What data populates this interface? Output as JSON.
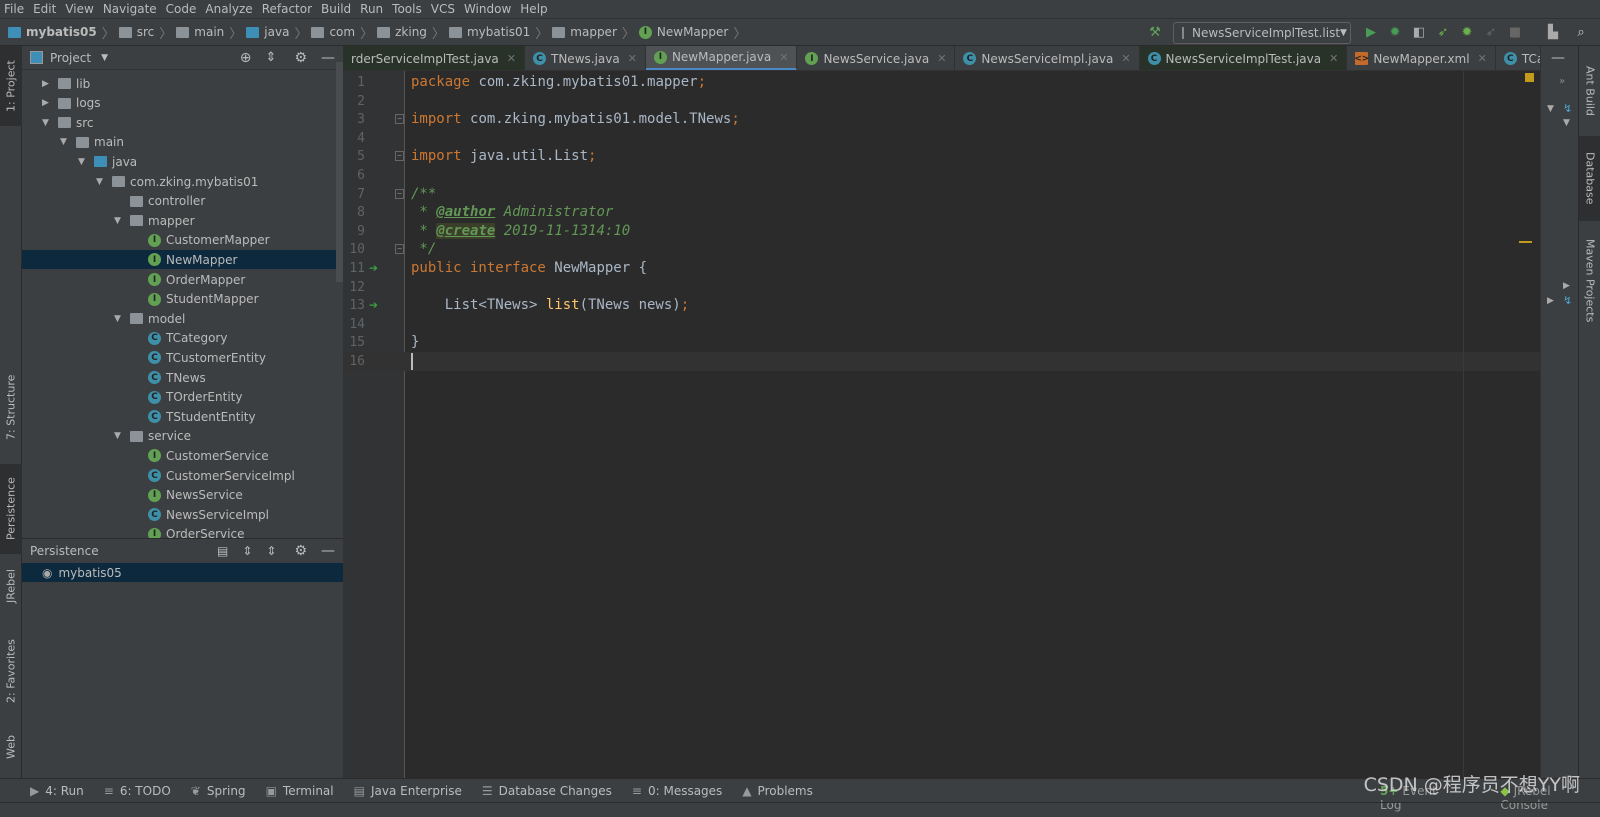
{
  "menu": [
    "File",
    "Edit",
    "View",
    "Navigate",
    "Code",
    "Analyze",
    "Refactor",
    "Build",
    "Run",
    "Tools",
    "VCS",
    "Window",
    "Help"
  ],
  "breadcrumb": [
    {
      "label": "mybatis05",
      "icon": "module"
    },
    {
      "label": "src",
      "icon": "folder"
    },
    {
      "label": "main",
      "icon": "folder"
    },
    {
      "label": "java",
      "icon": "source-folder"
    },
    {
      "label": "com",
      "icon": "package"
    },
    {
      "label": "zking",
      "icon": "package"
    },
    {
      "label": "mybatis01",
      "icon": "package"
    },
    {
      "label": "mapper",
      "icon": "package"
    },
    {
      "label": "NewMapper",
      "icon": "interface"
    }
  ],
  "toolbar": {
    "run_config": "NewsServiceImplTest.list"
  },
  "left_tools": [
    "1: Project",
    "7: Structure",
    "Persistence",
    "JRebel",
    "2: Favorites",
    "Web"
  ],
  "right_tools": [
    "Ant Build",
    "Database",
    "Maven Projects"
  ],
  "project": {
    "title": "Project",
    "tree": [
      {
        "label": "lib",
        "depth": 0,
        "type": "folder",
        "expand": "closed"
      },
      {
        "label": "logs",
        "depth": 0,
        "type": "folder",
        "expand": "closed"
      },
      {
        "label": "src",
        "depth": 0,
        "type": "folder",
        "expand": "open"
      },
      {
        "label": "main",
        "depth": 1,
        "type": "folder",
        "expand": "open"
      },
      {
        "label": "java",
        "depth": 2,
        "type": "source-folder",
        "expand": "open"
      },
      {
        "label": "com.zking.mybatis01",
        "depth": 3,
        "type": "package",
        "expand": "open"
      },
      {
        "label": "controller",
        "depth": 4,
        "type": "package",
        "expand": "none"
      },
      {
        "label": "mapper",
        "depth": 4,
        "type": "package",
        "expand": "open"
      },
      {
        "label": "CustomerMapper",
        "depth": 5,
        "type": "I"
      },
      {
        "label": "NewMapper",
        "depth": 5,
        "type": "I",
        "selected": true
      },
      {
        "label": "OrderMapper",
        "depth": 5,
        "type": "I"
      },
      {
        "label": "StudentMapper",
        "depth": 5,
        "type": "I"
      },
      {
        "label": "model",
        "depth": 4,
        "type": "package",
        "expand": "open"
      },
      {
        "label": "TCategory",
        "depth": 5,
        "type": "C"
      },
      {
        "label": "TCustomerEntity",
        "depth": 5,
        "type": "C"
      },
      {
        "label": "TNews",
        "depth": 5,
        "type": "C"
      },
      {
        "label": "TOrderEntity",
        "depth": 5,
        "type": "C"
      },
      {
        "label": "TStudentEntity",
        "depth": 5,
        "type": "C"
      },
      {
        "label": "service",
        "depth": 4,
        "type": "package",
        "expand": "open"
      },
      {
        "label": "CustomerService",
        "depth": 5,
        "type": "I"
      },
      {
        "label": "CustomerServiceImpl",
        "depth": 5,
        "type": "C"
      },
      {
        "label": "NewsService",
        "depth": 5,
        "type": "I"
      },
      {
        "label": "NewsServiceImpl",
        "depth": 5,
        "type": "C"
      },
      {
        "label": "OrderService",
        "depth": 5,
        "type": "I"
      }
    ]
  },
  "persistence": {
    "title": "Persistence",
    "items": [
      "mybatis05"
    ]
  },
  "tabs": [
    {
      "label": "rderServiceImplTest.java",
      "icon": "C",
      "test": true
    },
    {
      "label": "TNews.java",
      "icon": "C"
    },
    {
      "label": "NewMapper.java",
      "icon": "I",
      "active": true
    },
    {
      "label": "NewsService.java",
      "icon": "I"
    },
    {
      "label": "NewsServiceImpl.java",
      "icon": "C"
    },
    {
      "label": "NewsServiceImplTest.java",
      "icon": "C",
      "test": true
    },
    {
      "label": "NewMapper.xml",
      "icon": "X"
    },
    {
      "label": "TCategory.java",
      "icon": "C"
    }
  ],
  "tabs_overflow": "3",
  "code": [
    [
      [
        "kw",
        "package "
      ],
      [
        "",
        "com.zking.mybatis01.mapper"
      ],
      [
        "kw",
        ";"
      ]
    ],
    [],
    [
      [
        "kw",
        "import "
      ],
      [
        "",
        "com.zking.mybatis01.model.TNews"
      ],
      [
        "kw",
        ";"
      ]
    ],
    [],
    [
      [
        "kw",
        "import "
      ],
      [
        "",
        "java.util.List"
      ],
      [
        "kw",
        ";"
      ]
    ],
    [],
    [
      [
        "cm",
        "/**"
      ]
    ],
    [
      [
        "cm",
        " * "
      ],
      [
        "tag",
        "@author"
      ],
      [
        "cm",
        " Administrator"
      ]
    ],
    [
      [
        "cm",
        " * "
      ],
      [
        "tag",
        "@create"
      ],
      [
        "cm",
        " 2019-11-1314:10"
      ]
    ],
    [
      [
        "cm",
        " */"
      ]
    ],
    [
      [
        "kw",
        "public interface "
      ],
      [
        "",
        "NewMapper {"
      ]
    ],
    [],
    [
      [
        "",
        "    List<TNews> "
      ],
      [
        "fn",
        "list"
      ],
      [
        "",
        "(TNews news)"
      ],
      [
        "kw",
        ";"
      ]
    ],
    [],
    [
      [
        "",
        "}"
      ]
    ],
    []
  ],
  "gutter_markers": [
    11,
    13
  ],
  "bottom_tools": [
    {
      "label": "4: Run",
      "icon": "▶"
    },
    {
      "label": "6: TODO",
      "icon": "≡"
    },
    {
      "label": "Spring",
      "icon": "❦"
    },
    {
      "label": "Terminal",
      "icon": "▣"
    },
    {
      "label": "Java Enterprise",
      "icon": "▤"
    },
    {
      "label": "Database Changes",
      "icon": "☰"
    },
    {
      "label": "0: Messages",
      "icon": "≡"
    },
    {
      "label": "Problems",
      "icon": "▲"
    }
  ],
  "bottom_right": [
    "Event Log",
    "JRebel Console"
  ],
  "watermark": "CSDN @程序员不想YY啊"
}
